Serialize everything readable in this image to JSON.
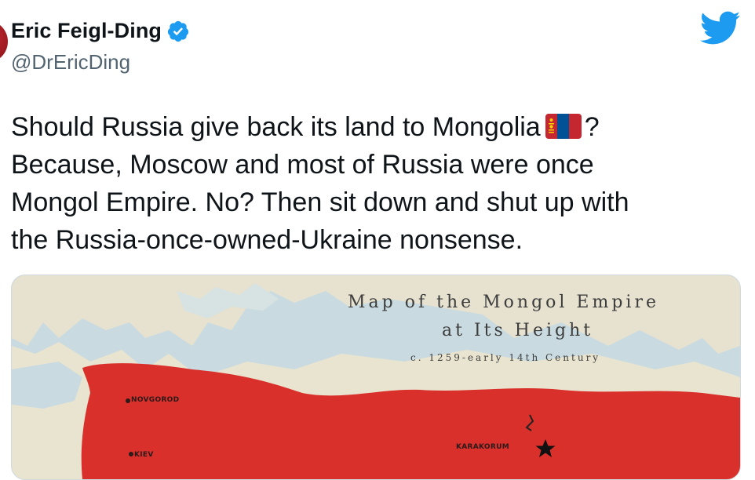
{
  "author": {
    "display_name": "Eric Feigl-Ding",
    "handle": "@DrEricDing",
    "verified_icon": "verified-badge-icon"
  },
  "brand_icon": "twitter-bird-icon",
  "colors": {
    "twitter_blue": "#1d9bf0",
    "empire_red": "#d9302b",
    "land": "#e8e3cf",
    "sea": "#c9dbe0"
  },
  "tweet": {
    "line1_before_flag": "Should Russia give back its land to Mongolia",
    "flag_icon": "mongolia-flag-icon",
    "line1_after_flag": "?",
    "line2": "Because, Moscow and most of Russia were once",
    "line3": "Mongol Empire. No? Then sit down  and shut up with",
    "line4": "the Russia-once-owned-Ukraine nonsense."
  },
  "media": {
    "title_line1": "Map of the Mongol Empire",
    "title_line2": "at Its Height",
    "title_line3": "c. 1259-early 14th Century",
    "cities": {
      "novgorod": "NOVGOROD",
      "kiev": "KIEV",
      "karakorum": "KARAKORUM"
    }
  }
}
